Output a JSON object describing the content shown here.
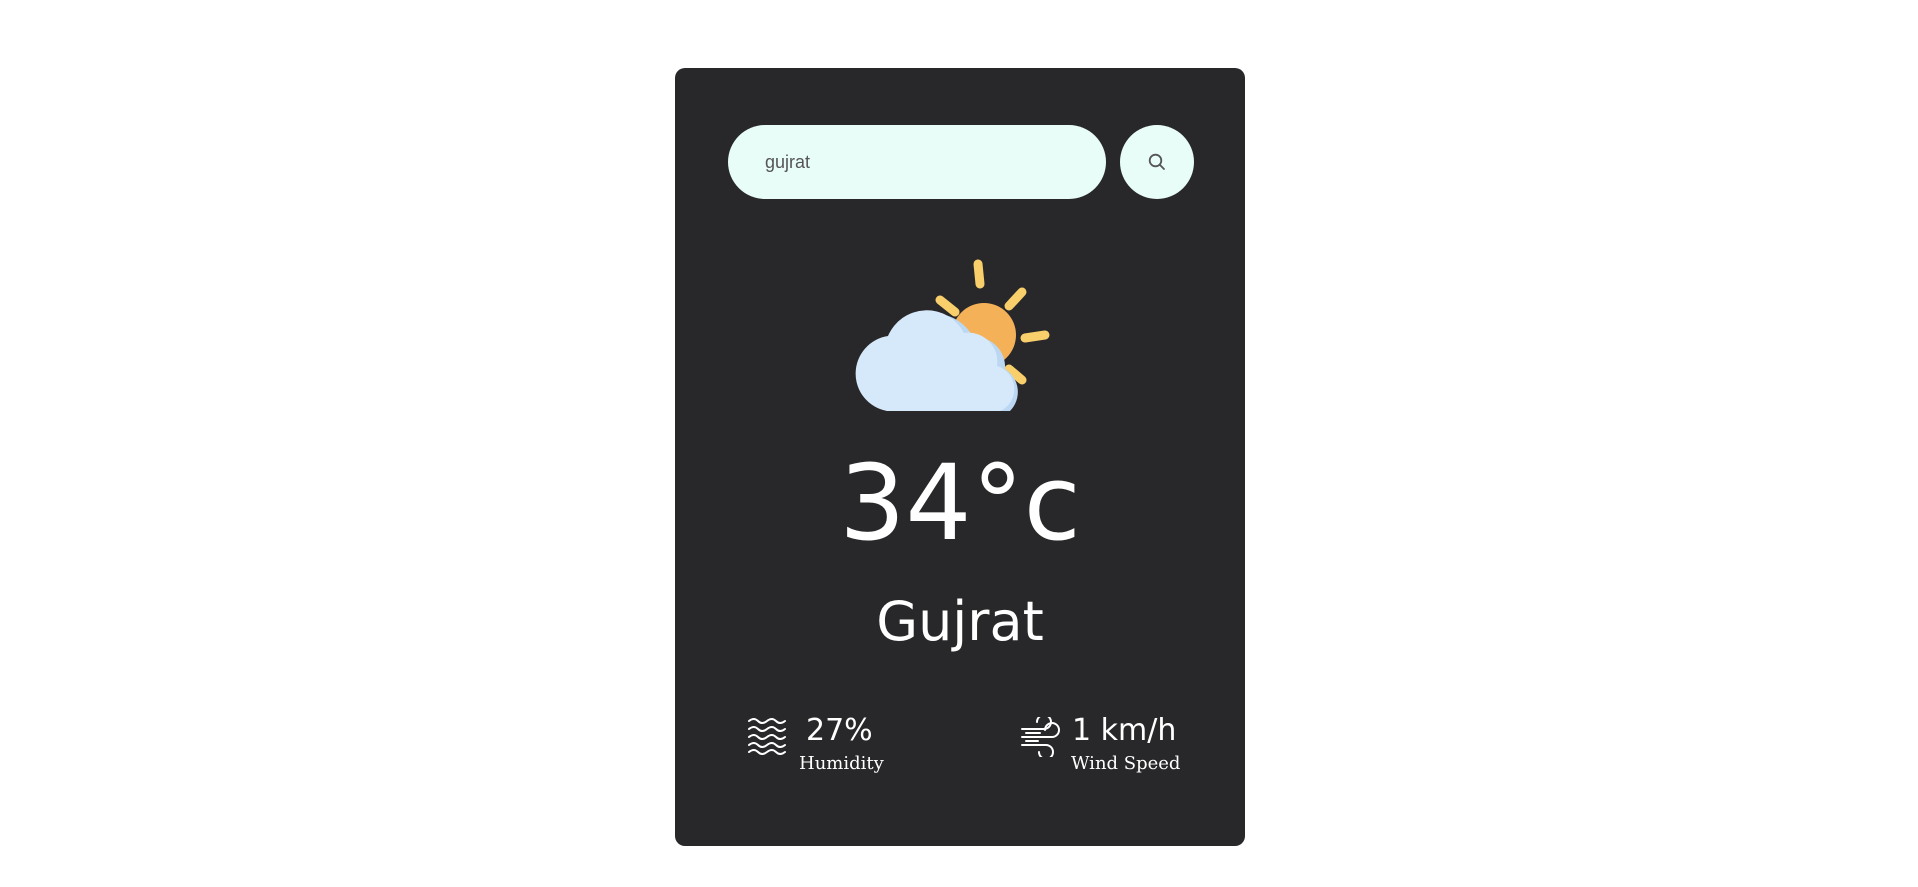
{
  "search": {
    "value": "gujrat",
    "button_icon": "search-icon"
  },
  "weather": {
    "icon": "partly-cloudy-icon",
    "temperature": "34°c",
    "city": "Gujrat"
  },
  "details": {
    "humidity": {
      "icon": "humidity-icon",
      "value": "27%",
      "label": "Humidity"
    },
    "wind": {
      "icon": "wind-icon",
      "value": "1 km/h",
      "label": "Wind Speed"
    }
  },
  "colors": {
    "page_background": "#ffffff",
    "card_background": "#28282a",
    "input_background": "#e8fcf8",
    "sun": "#f5b158",
    "sun_rays": "#f8cf6b",
    "cloud": "#d6e9fb",
    "cloud_shade": "#bcd7f2",
    "text": "#ffffff"
  }
}
